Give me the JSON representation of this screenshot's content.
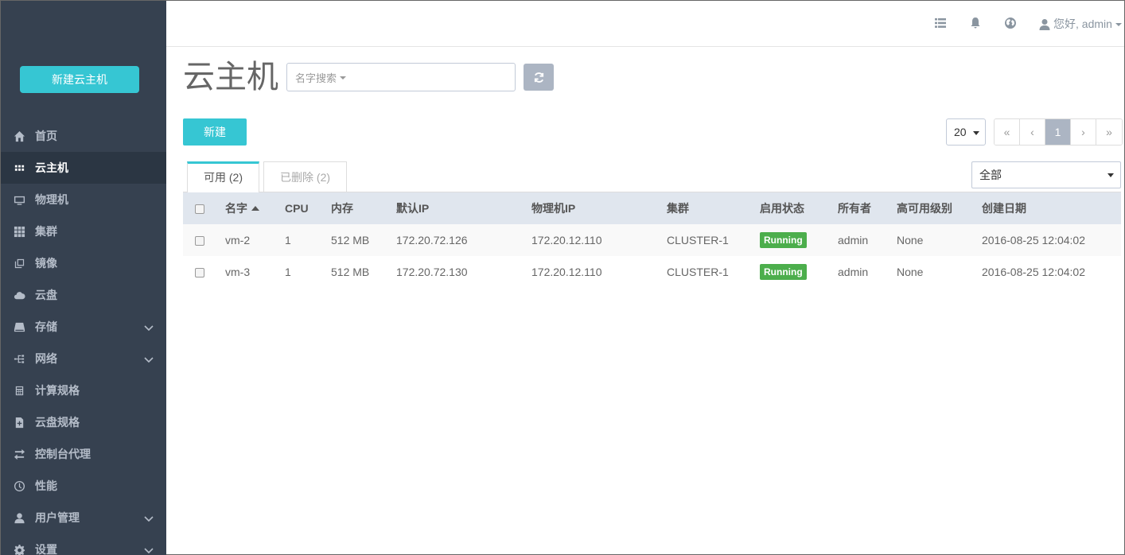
{
  "sidebar": {
    "new_vm_label": "新建云主机",
    "items": [
      {
        "label": "首页",
        "icon": "home-icon"
      },
      {
        "label": "云主机",
        "icon": "grid-icon",
        "active": true
      },
      {
        "label": "物理机",
        "icon": "monitor-icon"
      },
      {
        "label": "集群",
        "icon": "cluster-icon"
      },
      {
        "label": "镜像",
        "icon": "image-icon"
      },
      {
        "label": "云盘",
        "icon": "cloud-icon"
      },
      {
        "label": "存储",
        "icon": "storage-icon",
        "expandable": true
      },
      {
        "label": "网络",
        "icon": "network-icon",
        "expandable": true
      },
      {
        "label": "计算规格",
        "icon": "calculator-icon"
      },
      {
        "label": "云盘规格",
        "icon": "disk-spec-icon"
      },
      {
        "label": "控制台代理",
        "icon": "transfer-icon"
      },
      {
        "label": "性能",
        "icon": "dashboard-icon"
      },
      {
        "label": "用户管理",
        "icon": "user-icon",
        "expandable": true
      },
      {
        "label": "设置",
        "icon": "settings-icon",
        "expandable": true
      }
    ]
  },
  "header": {
    "greeting": "您好, admin"
  },
  "main": {
    "title": "云主机",
    "search_placeholder": "名字搜索",
    "create_label": "新建",
    "page_size": "20",
    "pager": [
      "«",
      "‹",
      "1",
      "›",
      "»"
    ],
    "tabs": [
      {
        "label": "可用",
        "count": "(2)"
      },
      {
        "label": "已删除",
        "count": "(2)"
      }
    ],
    "filter_value": "全部",
    "table": {
      "columns": [
        "名字",
        "CPU",
        "内存",
        "默认IP",
        "物理机IP",
        "集群",
        "启用状态",
        "所有者",
        "高可用级别",
        "创建日期"
      ],
      "rows": [
        {
          "name": "vm-2",
          "cpu": "1",
          "memory": "512 MB",
          "ip": "172.20.72.126",
          "host_ip": "172.20.12.110",
          "cluster": "CLUSTER-1",
          "status": "Running",
          "owner": "admin",
          "ha": "None",
          "created": "2016-08-25 12:04:02"
        },
        {
          "name": "vm-3",
          "cpu": "1",
          "memory": "512 MB",
          "ip": "172.20.72.130",
          "host_ip": "172.20.12.110",
          "cluster": "CLUSTER-1",
          "status": "Running",
          "owner": "admin",
          "ha": "None",
          "created": "2016-08-25 12:04:02"
        }
      ]
    }
  },
  "colors": {
    "accent": "#36c6d3",
    "sidebar": "#364150",
    "running": "#4cae4c"
  }
}
